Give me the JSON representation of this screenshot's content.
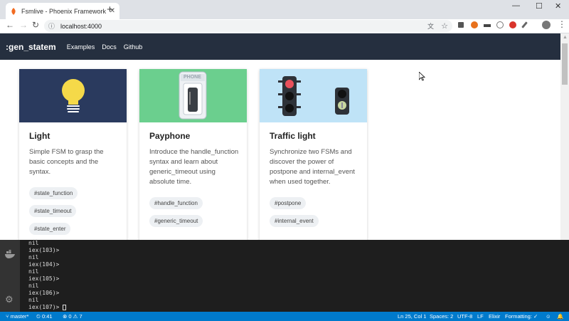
{
  "browser": {
    "tab_title": "Fsmlive - Phoenix Framework",
    "url": "localhost:4000"
  },
  "navbar": {
    "brand": ":gen_statem",
    "links": [
      "Examples",
      "Docs",
      "Github"
    ]
  },
  "cards": [
    {
      "title": "Light",
      "description": "Simple FSM to grasp the basic concepts and the syntax.",
      "tags": [
        "#state_function",
        "#state_timeout",
        "#state_enter"
      ],
      "image_bg": "#2a3a5e"
    },
    {
      "title": "Payphone",
      "description": "Introduce the handle_function syntax and learn about generic_timeout using absolute time.",
      "tags": [
        "#handle_function",
        "#generic_timeout"
      ],
      "image_bg": "#6bcf8e",
      "image_label": "PHONE"
    },
    {
      "title": "Traffic light",
      "description": "Synchronize two FSMs and discover the power of postpone and internal_event when used together.",
      "tags": [
        "#postpone",
        "#internal_event"
      ],
      "image_bg": "#bfe3f7"
    }
  ],
  "terminal": {
    "lines": [
      "nil",
      "iex(103)>",
      "nil",
      "iex(104)>",
      "nil",
      "iex(105)>",
      "nil",
      "iex(106)>",
      "nil",
      "iex(107)> "
    ]
  },
  "statusbar": {
    "branch": "master*",
    "time": "0:41",
    "errors": "0",
    "warnings": "7",
    "position": "Ln 25, Col 1",
    "spaces": "Spaces: 2",
    "encoding": "UTF-8",
    "eol": "LF",
    "language": "Elixir",
    "formatting": "Formatting: ✓"
  },
  "colors": {
    "navbar": "#252f3f",
    "statusbar": "#007acc",
    "terminal": "#1e1e1e"
  }
}
